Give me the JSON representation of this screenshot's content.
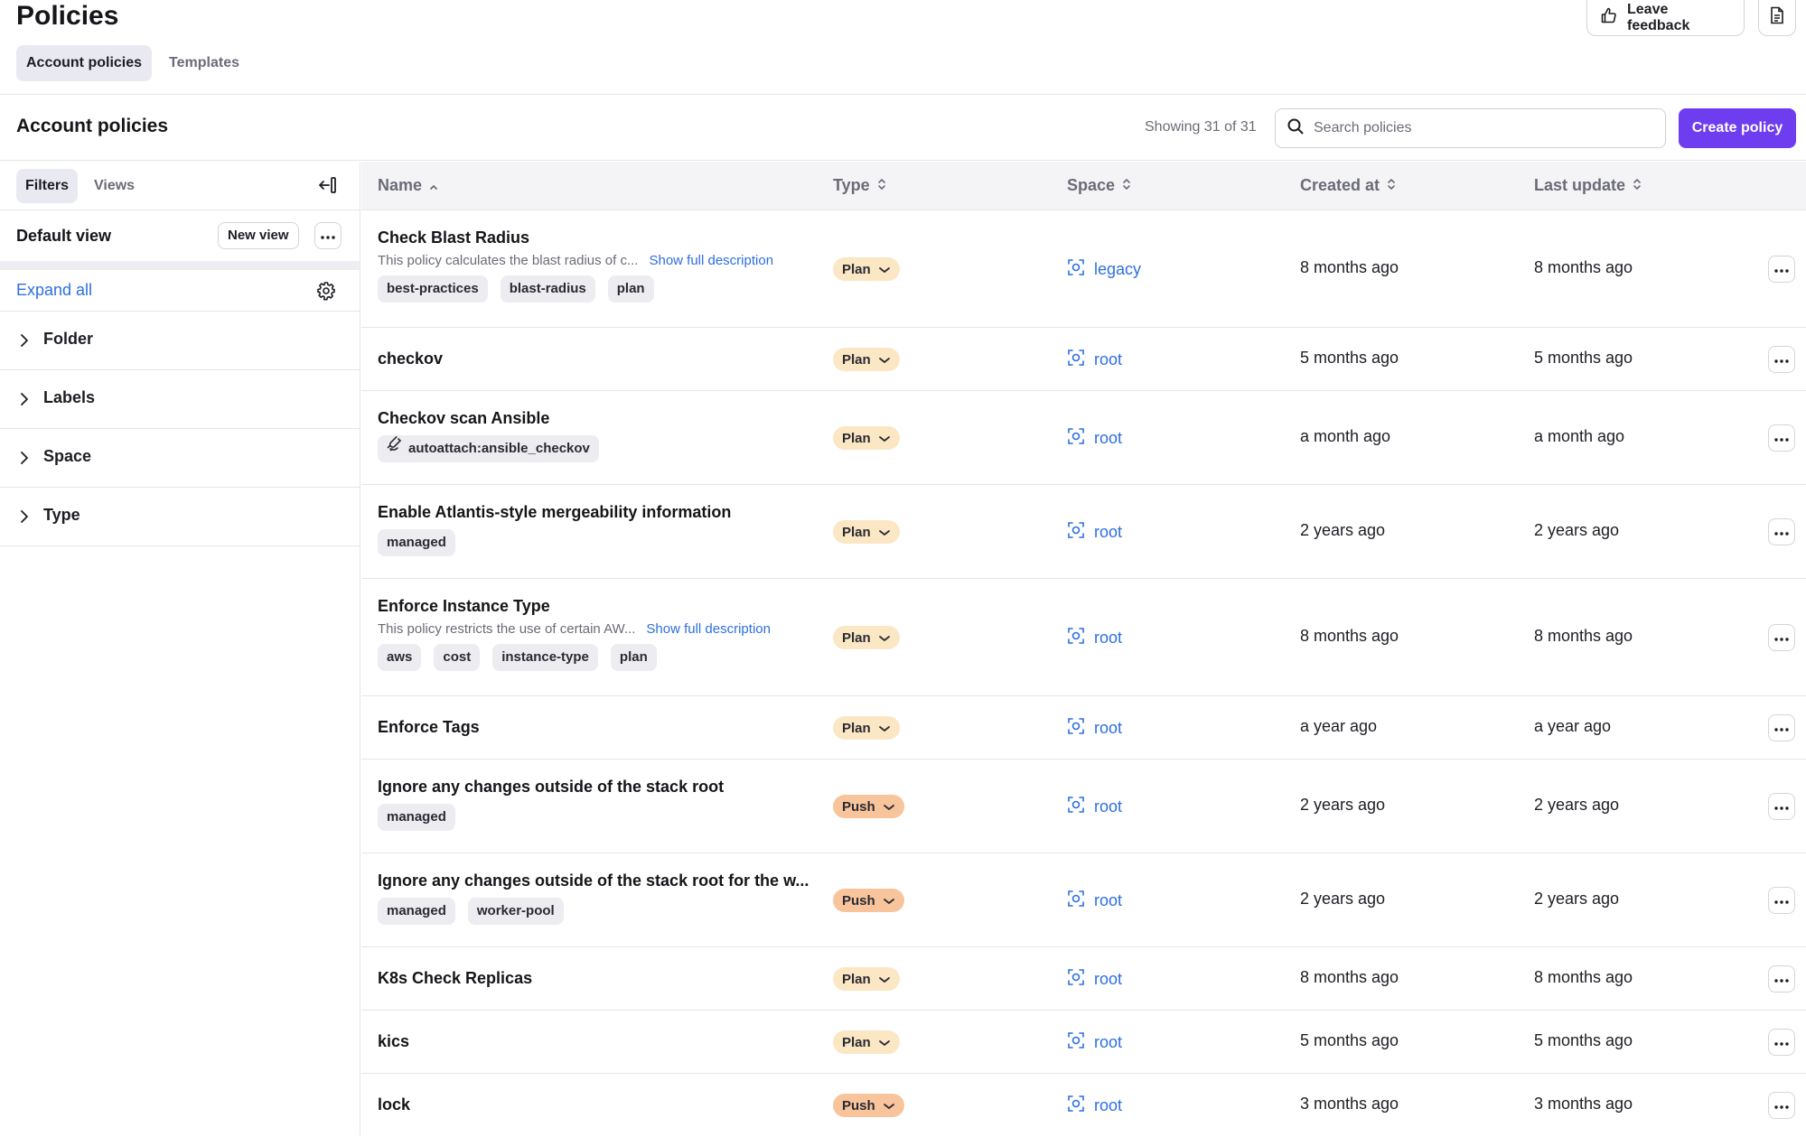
{
  "header": {
    "title": "Policies",
    "tabs": [
      {
        "label": "Account policies",
        "active": true
      },
      {
        "label": "Templates",
        "active": false
      }
    ],
    "feedback_label": "Leave feedback"
  },
  "section": {
    "title": "Account policies",
    "showing": "Showing 31 of 31",
    "search_placeholder": "Search policies",
    "create_label": "Create policy"
  },
  "sidebar": {
    "tabs": [
      "Filters",
      "Views"
    ],
    "default_view": "Default view",
    "new_view_label": "New view",
    "expand_all": "Expand all",
    "groups": [
      "Folder",
      "Labels",
      "Space",
      "Type"
    ]
  },
  "table": {
    "columns": {
      "name": "Name",
      "type": "Type",
      "space": "Space",
      "created": "Created at",
      "updated": "Last update"
    },
    "rows": [
      {
        "name": "Check Blast Radius",
        "desc": "This policy calculates the blast radius of c...",
        "show_full": "Show full description",
        "labels": [
          "best-practices",
          "blast-radius",
          "plan"
        ],
        "type": "Plan",
        "space": "legacy",
        "created": "8 months ago",
        "updated": "8 months ago"
      },
      {
        "name": "checkov",
        "labels": [],
        "type": "Plan",
        "space": "root",
        "created": "5 months ago",
        "updated": "5 months ago"
      },
      {
        "name": "Checkov scan Ansible",
        "labels": [],
        "autoattach": "autoattach:ansible_checkov",
        "type": "Plan",
        "space": "root",
        "created": "a month ago",
        "updated": "a month ago"
      },
      {
        "name": "Enable Atlantis-style mergeability information",
        "labels": [
          "managed"
        ],
        "type": "Plan",
        "space": "root",
        "created": "2 years ago",
        "updated": "2 years ago"
      },
      {
        "name": "Enforce Instance Type",
        "desc": "This policy restricts the use of certain AW...",
        "show_full": "Show full description",
        "labels": [
          "aws",
          "cost",
          "instance-type",
          "plan"
        ],
        "type": "Plan",
        "space": "root",
        "created": "8 months ago",
        "updated": "8 months ago"
      },
      {
        "name": "Enforce Tags",
        "labels": [],
        "type": "Plan",
        "space": "root",
        "created": "a year ago",
        "updated": "a year ago"
      },
      {
        "name": "Ignore any changes outside of the stack root",
        "labels": [
          "managed"
        ],
        "type": "Push",
        "space": "root",
        "created": "2 years ago",
        "updated": "2 years ago"
      },
      {
        "name": "Ignore any changes outside of the stack root for the w...",
        "labels": [
          "managed",
          "worker-pool"
        ],
        "type": "Push",
        "space": "root",
        "created": "2 years ago",
        "updated": "2 years ago"
      },
      {
        "name": "K8s Check Replicas",
        "labels": [],
        "type": "Plan",
        "space": "root",
        "created": "8 months ago",
        "updated": "8 months ago"
      },
      {
        "name": "kics",
        "labels": [],
        "type": "Plan",
        "space": "root",
        "created": "5 months ago",
        "updated": "5 months ago"
      },
      {
        "name": "lock",
        "labels": [],
        "type": "Push",
        "space": "root",
        "created": "3 months ago",
        "updated": "3 months ago"
      }
    ]
  },
  "icons": {
    "feedback": "thumbs-up-icon",
    "docs": "document-icon",
    "search": "search-icon",
    "collapse": "collapse-panel-icon",
    "settings": "gear-icon",
    "space": "space-icon",
    "more": "more-icon"
  },
  "colors": {
    "accent": "#6e3df0",
    "link": "#2d6fe0",
    "plan_badge": "#fbe7c4",
    "push_badge": "#f8c49c"
  }
}
